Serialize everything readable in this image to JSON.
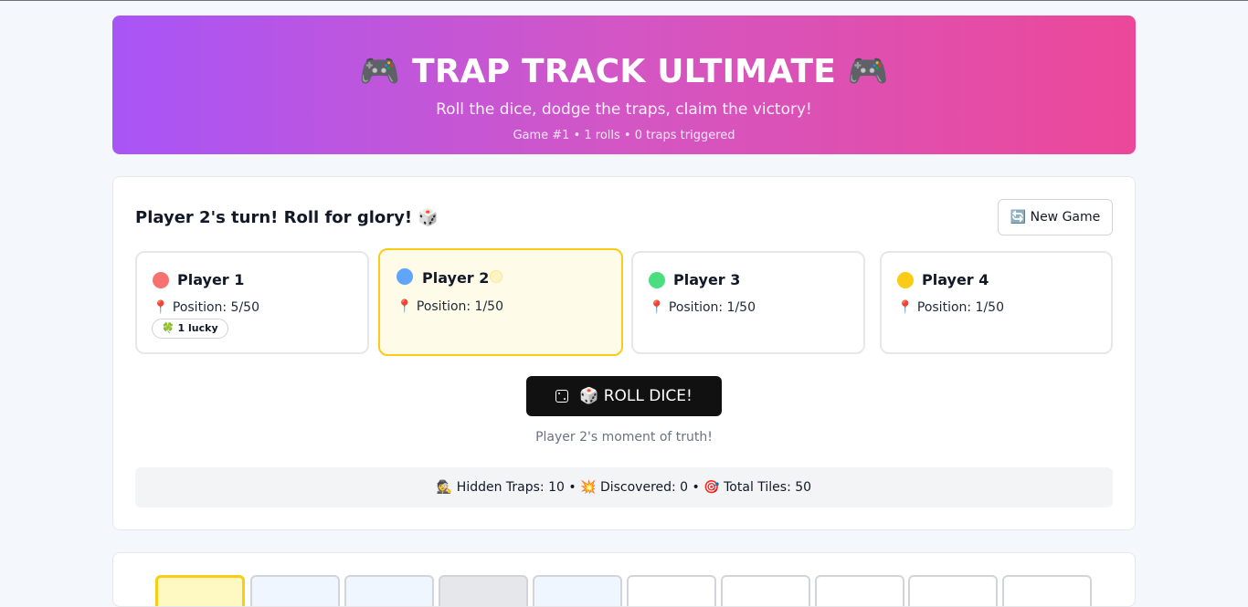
{
  "header": {
    "title": "🎮 TRAP TRACK ULTIMATE 🎮",
    "subtitle": "Roll the dice, dodge the traps, claim the victory!",
    "meta": "Game #1 • 1 rolls • 0 traps triggered"
  },
  "main": {
    "turn_text": "Player 2's turn! Roll for glory! 🎲",
    "new_game_label": "🔄 New Game",
    "roll_label": "🎲 ROLL DICE!",
    "moment_text": "Player 2's moment of truth!",
    "stats_text": "🕵️ Hidden Traps: 10 • 💥 Discovered: 0 • 🎯 Total Tiles: 50"
  },
  "players": [
    {
      "name": "Player 1",
      "position": "📍 Position: 5/50",
      "color": "#f87171",
      "badge": "🍀 1 lucky"
    },
    {
      "name": "Player 2",
      "position": "📍 Position: 1/50",
      "color": "#60a5fa",
      "active": true
    },
    {
      "name": "Player 3",
      "position": "📍 Position: 1/50",
      "color": "#4ade80"
    },
    {
      "name": "Player 4",
      "position": "📍 Position: 1/50",
      "color": "#facc15"
    }
  ],
  "colors": {
    "header_gradient_start": "#a855f7",
    "header_gradient_end": "#ec4899",
    "active_border": "#facc15",
    "roll_button": "#111111"
  }
}
